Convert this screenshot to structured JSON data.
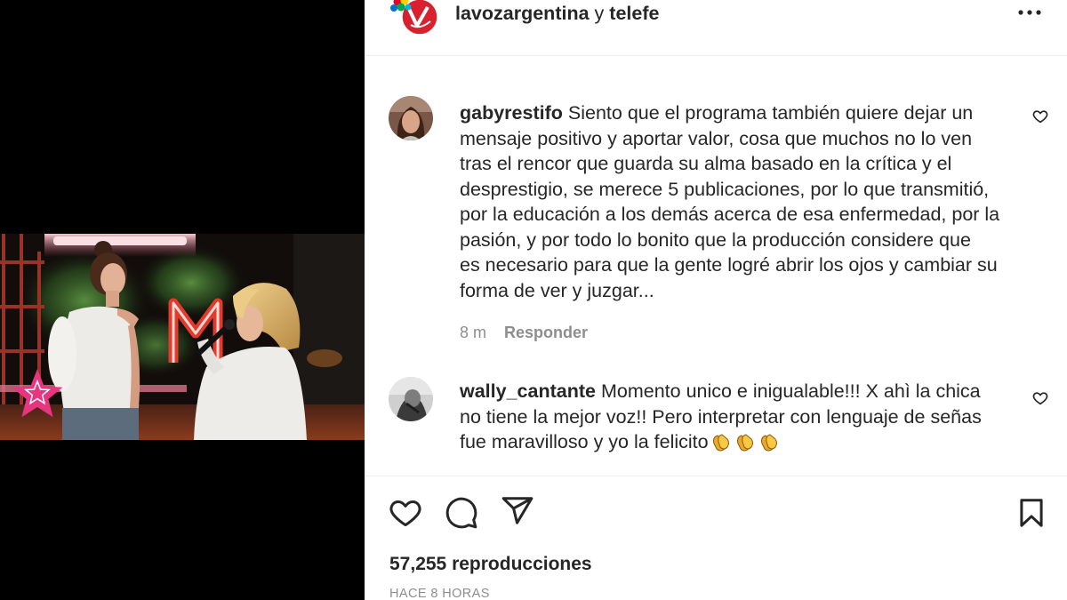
{
  "post": {
    "author": "lavozargentina",
    "joiner": "y",
    "coauthor": "telefe",
    "more_icon": "more-horizontal-icon"
  },
  "comments": [
    {
      "username": "gabyrestifo",
      "lines": [
        "Siento que el programa también quiere dejar un",
        "mensaje positivo y aportar valor, cosa que muchos no lo ven",
        "tras el rencor que guarda su alma basado en la crítica y el",
        "desprestigio, se merece 5 publicaciones, por lo que transmitió,",
        "por la educación a los demás acerca de esa enfermedad, por la",
        "pasión, y por todo lo bonito que la producción considere que",
        "es necesario para que la gente logré abrir los ojos y cambiar su",
        "forma de ver y juzgar..."
      ],
      "time": "8 m",
      "reply_label": "Responder",
      "like_icon": "heart-outline-icon"
    },
    {
      "username": "wally_cantante",
      "lines": [
        "Momento unico e inigualable!!! X ahì la chica",
        "no tiene la mejor voz!! Pero interpretar con lenguaje de señas",
        "fue maravilloso y yo la felicito"
      ],
      "emoji_icons": [
        "clapping-hands-icon",
        "clapping-hands-icon",
        "clapping-hands-icon"
      ],
      "like_icon": "heart-outline-icon"
    }
  ],
  "actions": {
    "like_icon": "heart-outline-icon",
    "comment_icon": "comment-bubble-icon",
    "share_icon": "send-icon",
    "save_icon": "bookmark-icon"
  },
  "views": "57,255 reproducciones",
  "timestamp": "HACE 8 HORAS",
  "colors": {
    "text": "#262626",
    "secondary_text": "#8e8e8e",
    "divider": "#efefef",
    "media_background": "#000000",
    "brand_red": "#d8202f"
  }
}
